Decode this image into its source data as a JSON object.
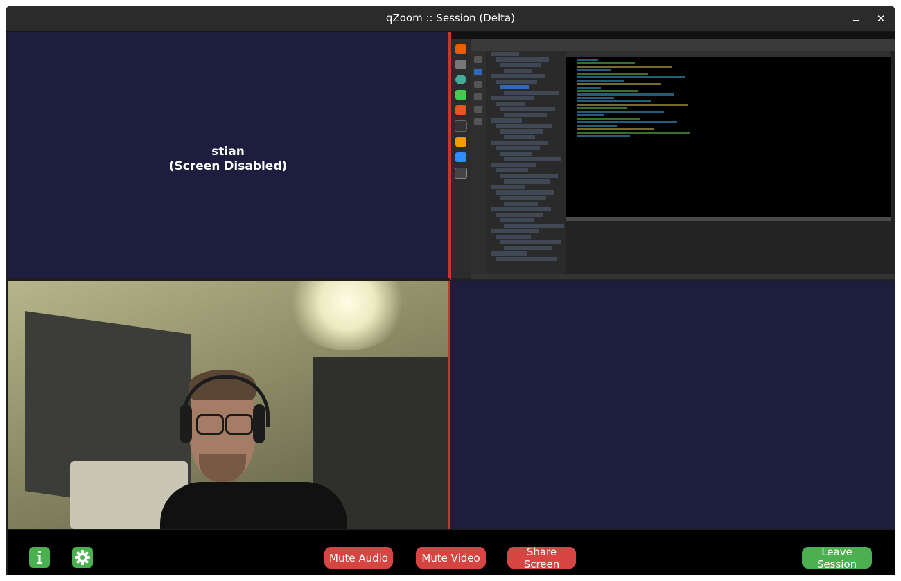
{
  "window": {
    "title": "qZoom :: Session (Delta)",
    "minimize_icon": "minimize-icon",
    "close_label": "✕"
  },
  "tiles": {
    "participant_1": {
      "name": "stian",
      "status": "(Screen Disabled)"
    }
  },
  "toolbar": {
    "info_icon": "info-icon",
    "settings_icon": "gear-icon",
    "mute_audio_label": "Mute Audio",
    "mute_video_label": "Mute Video",
    "share_screen_label": "Share Screen",
    "leave_session_label": "Leave Session"
  },
  "colors": {
    "tile_background": "#1d1d3e",
    "active_border": "#c0392b",
    "danger_button": "#d64541",
    "success_button": "#4caf50",
    "toolbar_background": "#000000"
  }
}
